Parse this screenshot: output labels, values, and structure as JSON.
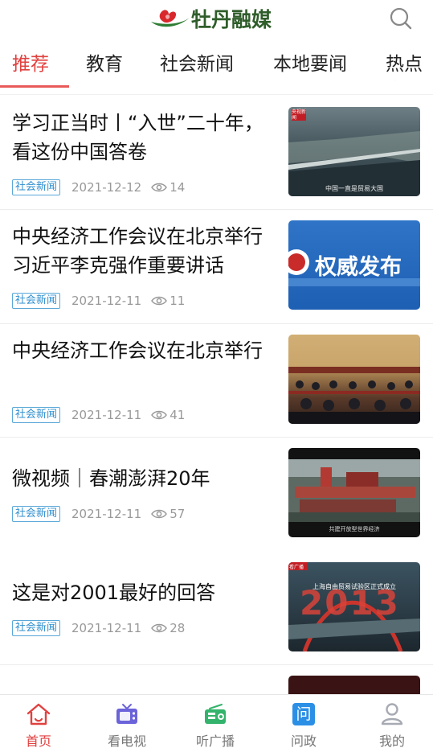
{
  "header": {
    "app_name": "牡丹融媒",
    "search_icon": "search-icon"
  },
  "tabs": [
    {
      "label": "推荐",
      "active": true
    },
    {
      "label": "教育"
    },
    {
      "label": "社会新闻"
    },
    {
      "label": "本地要闻"
    },
    {
      "label": "热点资"
    }
  ],
  "feed": [
    {
      "title": "学习正当时丨“入世”二十年，看这份中国答卷",
      "tag": "社会新闻",
      "date": "2021-12-12",
      "views": "14",
      "thumb_caption": "中国一直是贸易大国",
      "thumb_badge": "央视新闻"
    },
    {
      "title": "中央经济工作会议在北京举行 习近平李克强作重要讲话",
      "tag": "社会新闻",
      "date": "2021-12-11",
      "views": "11",
      "thumb_caption": "权威发布"
    },
    {
      "title": "中央经济工作会议在北京举行",
      "tag": "社会新闻",
      "date": "2021-12-11",
      "views": "41"
    },
    {
      "title": "微视频｜春潮澎湃20年",
      "tag": "社会新闻",
      "date": "2021-12-11",
      "views": "57",
      "thumb_caption": "共建开放型世界经济"
    },
    {
      "title": "这是对2001最好的回答",
      "tag": "社会新闻",
      "date": "2021-12-11",
      "views": "28",
      "thumb_caption": "上海自由贸易试验区正式成立",
      "thumb_year": "2013",
      "thumb_badge": "看广播"
    }
  ],
  "tabbar": [
    {
      "label": "首页",
      "icon": "home-icon",
      "active": true
    },
    {
      "label": "看电视",
      "icon": "tv-icon"
    },
    {
      "label": "听广播",
      "icon": "radio-icon"
    },
    {
      "label": "问政",
      "icon": "ask-gov-icon",
      "glyph": "问"
    },
    {
      "label": "我的",
      "icon": "profile-icon"
    }
  ],
  "colors": {
    "accent": "#e0413f",
    "tag": "#2f8fcf",
    "tv": "#6b63d9",
    "radio": "#33b36b",
    "ask": "#2c8fe6",
    "profile": "#a7aab3"
  }
}
